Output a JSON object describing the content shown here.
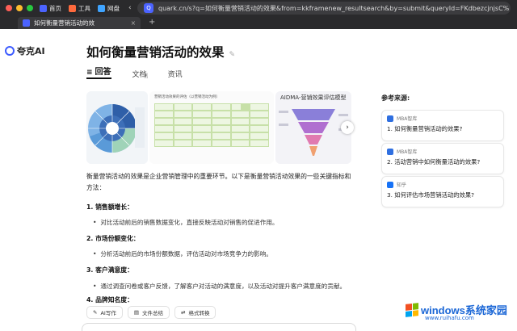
{
  "browser": {
    "traffic_colors": [
      "#ff5f57",
      "#febc2e",
      "#28c840"
    ],
    "bookmarks": [
      {
        "label": "首页",
        "color": "#4b63ff"
      },
      {
        "label": "工具",
        "color": "#ff6a3d"
      },
      {
        "label": "网盘",
        "color": "#3fa4ff"
      }
    ],
    "url": "quark.cn/s?q=如何衡量营销活动的效果&from=kkframenew_resultsearch&by=submit&queryId=FKdbezcjnjsC%",
    "tab_title": "如何衡量营销活动的效",
    "tab_close": "×",
    "new_tab": "+"
  },
  "logo": {
    "text": "夸克AI",
    "color": "#3d5cff"
  },
  "page": {
    "title": "如何衡量营销活动的效果",
    "edit_icon": "✎",
    "tabs": [
      {
        "label": "回答",
        "active": true
      },
      {
        "label": "文档",
        "active": false
      },
      {
        "label": "资讯",
        "active": false
      }
    ],
    "images": {
      "card3_title": "AIDMA-营销效果评估模型",
      "card2_caption": "营销活动效果的评估（以营销活动为例）",
      "next": "›"
    },
    "intro": "衡量营销活动的效果是企业营销管理中的重要环节。以下是衡量营销活动效果的一些关键指标和方法：",
    "sections": [
      {
        "heading": "1. 销售额增长：",
        "item": "对比活动前后的销售数据变化，直接反映活动对销售的促进作用。"
      },
      {
        "heading": "2. 市场份额变化：",
        "item": "分析活动前后的市场份额数据，评估活动对市场竞争力的影响。"
      },
      {
        "heading": "3. 客户满意度：",
        "item": "通过调查问卷或客户反馈，了解客户对活动的满意度，以及活动对提升客户满意度的贡献。"
      },
      {
        "heading": "4. 品牌知名度：",
        "item": ""
      }
    ],
    "toolbar": [
      "AI写作",
      "文件总结",
      "格式转换"
    ]
  },
  "references": {
    "heading": "参考来源:",
    "items": [
      {
        "source": "MBA智库",
        "title": "1. 如何衡量营销活动的效果?",
        "color": "#2f6fe0"
      },
      {
        "source": "MBA智库",
        "title": "2. 活动营销中如何衡量活动的效果?",
        "color": "#2f6fe0"
      },
      {
        "source": "知乎",
        "title": "3. 如何评估市场营销活动的效果?",
        "color": "#1772f6"
      }
    ]
  },
  "watermark": {
    "main": "windows系统家园",
    "sub": "www.ruihafu.com"
  }
}
